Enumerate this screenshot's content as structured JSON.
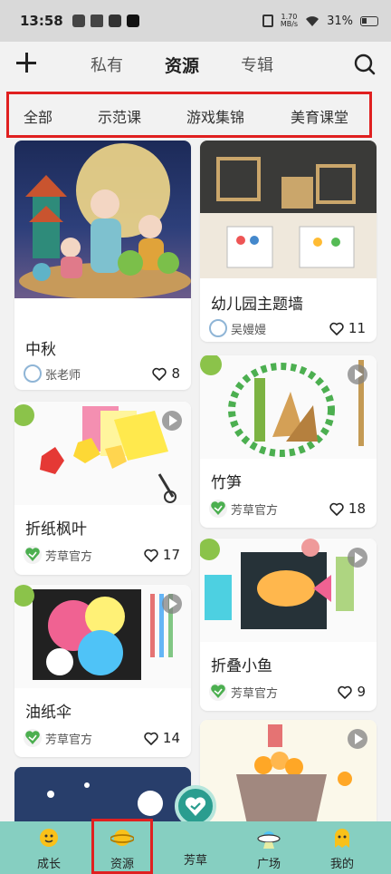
{
  "status": {
    "time": "13:58",
    "speed_top": "1.70",
    "speed_bottom": "MB/s",
    "battery": "31%"
  },
  "header": {
    "tabs": [
      "私有",
      "资源",
      "专辑"
    ],
    "active_tab": "资源"
  },
  "filter": {
    "items": [
      "全部",
      "示范课",
      "游戏集锦",
      "美育课堂"
    ]
  },
  "cards": [
    {
      "title": "中秋",
      "author": "张老师",
      "likes": "8",
      "video": false,
      "avatar": "user"
    },
    {
      "title": "幼儿园主题墙",
      "author": "吴嫚嫚",
      "likes": "11",
      "video": false,
      "avatar": "user"
    },
    {
      "title": "折纸枫叶",
      "author": "芳草官方",
      "likes": "17",
      "video": true,
      "avatar": "logo"
    },
    {
      "title": "竹笋",
      "author": "芳草官方",
      "likes": "18",
      "video": true,
      "avatar": "logo"
    },
    {
      "title": "油纸伞",
      "author": "芳草官方",
      "likes": "14",
      "video": true,
      "avatar": "logo"
    },
    {
      "title": "折叠小鱼",
      "author": "芳草官方",
      "likes": "9",
      "video": true,
      "avatar": "logo"
    },
    {
      "title": "",
      "author": "",
      "likes": "",
      "video": false,
      "avatar": "none"
    },
    {
      "title": "",
      "author": "",
      "likes": "",
      "video": true,
      "avatar": "none"
    }
  ],
  "bottom_nav": {
    "items": [
      {
        "label": "成长",
        "icon": "sun-face-icon"
      },
      {
        "label": "资源",
        "icon": "planet-icon"
      },
      {
        "label": "芳草",
        "icon": "heart-badge-icon"
      },
      {
        "label": "广场",
        "icon": "ufo-icon"
      },
      {
        "label": "我的",
        "icon": "ghost-icon"
      }
    ]
  },
  "colors": {
    "nav_bg": "#86cfc1",
    "accent": "#2a9d8f",
    "highlight_box": "#e02020"
  }
}
